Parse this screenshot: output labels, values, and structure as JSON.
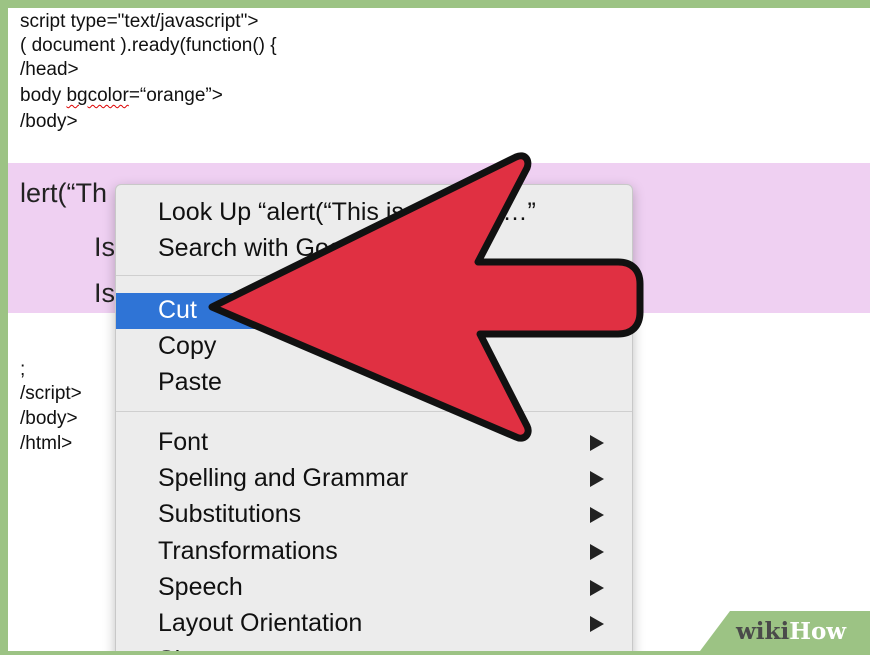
{
  "editor": {
    "code_top": [
      {
        "id": "script-open",
        "text": "script type=\"text/javascript\">"
      },
      {
        "id": "doc-ready",
        "text": "( document ).ready(function() {"
      },
      {
        "id": "head-close",
        "text": "/head>"
      },
      {
        "id": "body-open",
        "text_prefix": "body ",
        "text_error": "bgcolor",
        "text_suffix": "=“orange”>"
      },
      {
        "id": "body-close-1",
        "text": "/body>"
      }
    ],
    "selected_line": "lert(“Th",
    "selected_sub_1": "Is",
    "selected_sub_2": "Is",
    "code_bottom": [
      {
        "id": "semicolon",
        "text": ";"
      },
      {
        "id": "script-close",
        "text": "/script>"
      },
      {
        "id": "body-close-2",
        "text": "/body>"
      },
      {
        "id": "html-close",
        "text": "/html>"
      }
    ]
  },
  "context_menu": {
    "items": [
      {
        "label": "Look Up “alert(“This is an alert”…”",
        "submenu": false,
        "selected": false
      },
      {
        "label": "Search with Google",
        "submenu": false,
        "selected": false
      },
      {
        "label": "Cut",
        "submenu": false,
        "selected": true
      },
      {
        "label": "Copy",
        "submenu": false,
        "selected": false
      },
      {
        "label": "Paste",
        "submenu": false,
        "selected": false
      },
      {
        "label": "Font",
        "submenu": true,
        "selected": false
      },
      {
        "label": "Spelling and Grammar",
        "submenu": true,
        "selected": false
      },
      {
        "label": "Substitutions",
        "submenu": true,
        "selected": false
      },
      {
        "label": "Transformations",
        "submenu": true,
        "selected": false
      },
      {
        "label": "Speech",
        "submenu": true,
        "selected": false
      },
      {
        "label": "Layout Orientation",
        "submenu": true,
        "selected": false
      },
      {
        "label": "Share",
        "submenu": true,
        "selected": false
      }
    ]
  },
  "watermark": {
    "part1": "wiki",
    "part2": "How"
  },
  "colors": {
    "frame_green": "#9cc384",
    "selection_highlight": "#efd0f2",
    "menu_selected": "#2f74d6",
    "arrow_red": "#e03042"
  },
  "annotation": {
    "icon": "red-arrow-icon",
    "points_to": "Cut"
  }
}
